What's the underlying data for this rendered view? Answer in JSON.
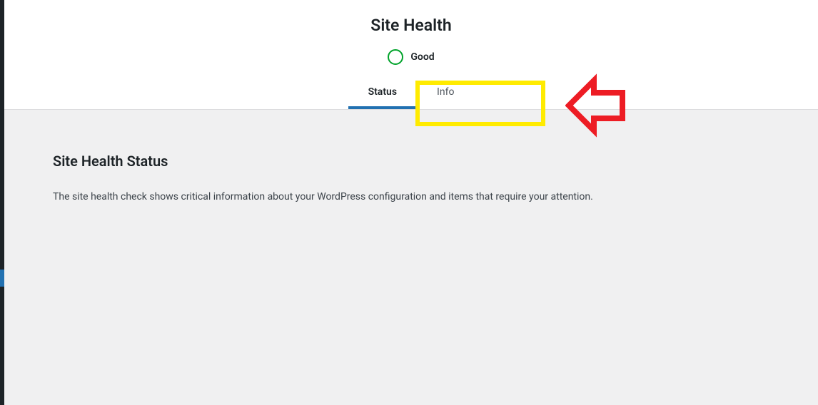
{
  "header": {
    "title": "Site Health",
    "status_label": "Good"
  },
  "tabs": {
    "status": "Status",
    "info": "Info"
  },
  "content": {
    "section_title": "Site Health Status",
    "description": "The site health check shows critical information about your WordPress configuration and items that require your attention."
  }
}
